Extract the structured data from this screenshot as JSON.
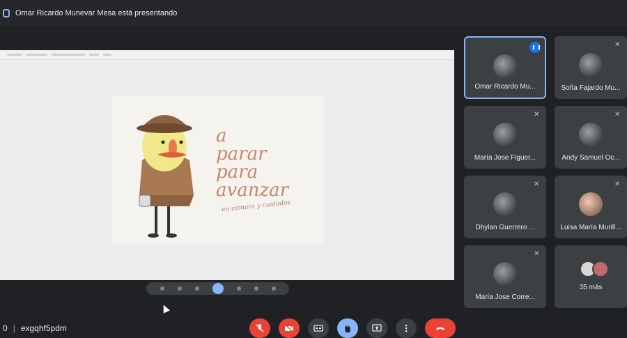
{
  "banner": {
    "presenting_text": "Omar Ricardo Munevar Mesa está presentando"
  },
  "slide": {
    "line1": "a",
    "line2": "parar",
    "line3": "para",
    "line4": "avanzar",
    "subtitle": "en cámara y cuidados"
  },
  "participants": [
    {
      "name": "Omar Ricardo Mu..."
    },
    {
      "name": "Sofía Fajardo Mu..."
    },
    {
      "name": "María Jose Figuer..."
    },
    {
      "name": "Andy Samuel Oc..."
    },
    {
      "name": "Dhylan Guerrero ..."
    },
    {
      "name": "Luisa María Murill..."
    },
    {
      "name": "María Jose Corre..."
    },
    {
      "name": "35 más"
    }
  ],
  "meeting": {
    "code_prefix": "0",
    "code": "exgqhf5pdm"
  },
  "colors": {
    "background": "#202124",
    "tile": "#3c4043",
    "accent": "#8ab4f8",
    "danger": "#ea4335"
  },
  "icons": {
    "presenting": "present-to-all-icon",
    "mic_off": "mic-off-icon",
    "cam_off": "videocam-off-icon",
    "captions": "closed-captions-icon",
    "hand": "raise-hand-icon",
    "present": "present-screen-icon",
    "more": "more-vert-icon",
    "hangup": "call-end-icon"
  }
}
